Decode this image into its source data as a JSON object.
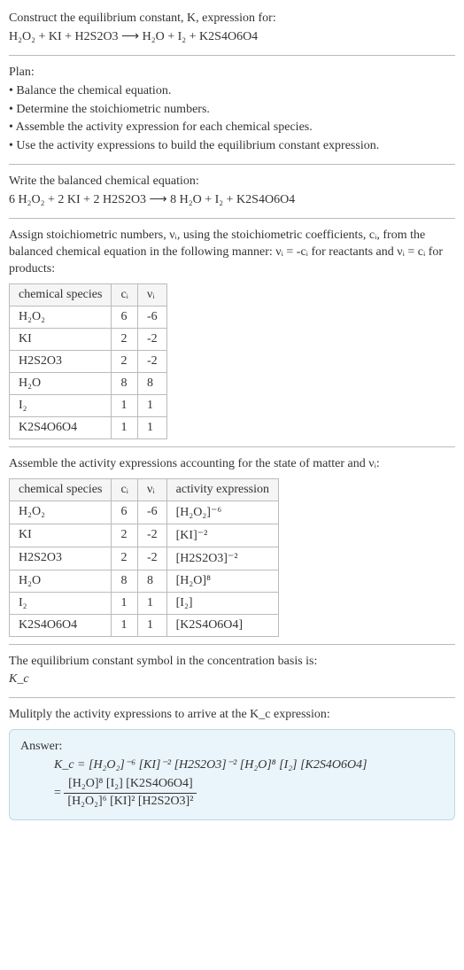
{
  "intro": {
    "line1": "Construct the equilibrium constant, K, expression for:",
    "equation": "H₂O₂ + KI + H2S2O3 ⟶ H₂O + I₂ + K2S4O6O4"
  },
  "plan": {
    "heading": "Plan:",
    "items": [
      "• Balance the chemical equation.",
      "• Determine the stoichiometric numbers.",
      "• Assemble the activity expression for each chemical species.",
      "• Use the activity expressions to build the equilibrium constant expression."
    ]
  },
  "balanced": {
    "lead": "Write the balanced chemical equation:",
    "equation": "6 H₂O₂ + 2 KI + 2 H2S2O3 ⟶ 8 H₂O + I₂ + K2S4O6O4"
  },
  "stoich_intro": "Assign stoichiometric numbers, νᵢ, using the stoichiometric coefficients, cᵢ, from the balanced chemical equation in the following manner: νᵢ = -cᵢ for reactants and νᵢ = cᵢ for products:",
  "stoich_table": {
    "headers": [
      "chemical species",
      "cᵢ",
      "νᵢ"
    ],
    "rows": [
      [
        "H₂O₂",
        "6",
        "-6"
      ],
      [
        "KI",
        "2",
        "-2"
      ],
      [
        "H2S2O3",
        "2",
        "-2"
      ],
      [
        "H₂O",
        "8",
        "8"
      ],
      [
        "I₂",
        "1",
        "1"
      ],
      [
        "K2S4O6O4",
        "1",
        "1"
      ]
    ]
  },
  "activity_intro": "Assemble the activity expressions accounting for the state of matter and νᵢ:",
  "activity_table": {
    "headers": [
      "chemical species",
      "cᵢ",
      "νᵢ",
      "activity expression"
    ],
    "rows": [
      [
        "H₂O₂",
        "6",
        "-6",
        "[H₂O₂]⁻⁶"
      ],
      [
        "KI",
        "2",
        "-2",
        "[KI]⁻²"
      ],
      [
        "H2S2O3",
        "2",
        "-2",
        "[H2S2O3]⁻²"
      ],
      [
        "H₂O",
        "8",
        "8",
        "[H₂O]⁸"
      ],
      [
        "I₂",
        "1",
        "1",
        "[I₂]"
      ],
      [
        "K2S4O6O4",
        "1",
        "1",
        "[K2S4O6O4]"
      ]
    ]
  },
  "symbol_block": {
    "line1": "The equilibrium constant symbol in the concentration basis is:",
    "line2": "K_c"
  },
  "multiply_line": "Mulitply the activity expressions to arrive at the K_c expression:",
  "answer": {
    "label": "Answer:",
    "expr_line": "K_c = [H₂O₂]⁻⁶ [KI]⁻² [H2S2O3]⁻² [H₂O]⁸ [I₂] [K2S4O6O4]",
    "frac_lead": "= ",
    "frac_num": "[H₂O]⁸ [I₂] [K2S4O6O4]",
    "frac_den": "[H₂O₂]⁶ [KI]² [H2S2O3]²"
  },
  "chart_data": {
    "type": "table",
    "tables": [
      {
        "title": "Stoichiometric numbers",
        "columns": [
          "chemical species",
          "c_i",
          "nu_i"
        ],
        "rows": [
          {
            "chemical species": "H2O2",
            "c_i": 6,
            "nu_i": -6
          },
          {
            "chemical species": "KI",
            "c_i": 2,
            "nu_i": -2
          },
          {
            "chemical species": "H2S2O3",
            "c_i": 2,
            "nu_i": -2
          },
          {
            "chemical species": "H2O",
            "c_i": 8,
            "nu_i": 8
          },
          {
            "chemical species": "I2",
            "c_i": 1,
            "nu_i": 1
          },
          {
            "chemical species": "K2S4O6O4",
            "c_i": 1,
            "nu_i": 1
          }
        ]
      },
      {
        "title": "Activity expressions",
        "columns": [
          "chemical species",
          "c_i",
          "nu_i",
          "activity expression"
        ],
        "rows": [
          {
            "chemical species": "H2O2",
            "c_i": 6,
            "nu_i": -6,
            "activity expression": "[H2O2]^-6"
          },
          {
            "chemical species": "KI",
            "c_i": 2,
            "nu_i": -2,
            "activity expression": "[KI]^-2"
          },
          {
            "chemical species": "H2S2O3",
            "c_i": 2,
            "nu_i": -2,
            "activity expression": "[H2S2O3]^-2"
          },
          {
            "chemical species": "H2O",
            "c_i": 8,
            "nu_i": 8,
            "activity expression": "[H2O]^8"
          },
          {
            "chemical species": "I2",
            "c_i": 1,
            "nu_i": 1,
            "activity expression": "[I2]"
          },
          {
            "chemical species": "K2S4O6O4",
            "c_i": 1,
            "nu_i": 1,
            "activity expression": "[K2S4O6O4]"
          }
        ]
      }
    ]
  }
}
